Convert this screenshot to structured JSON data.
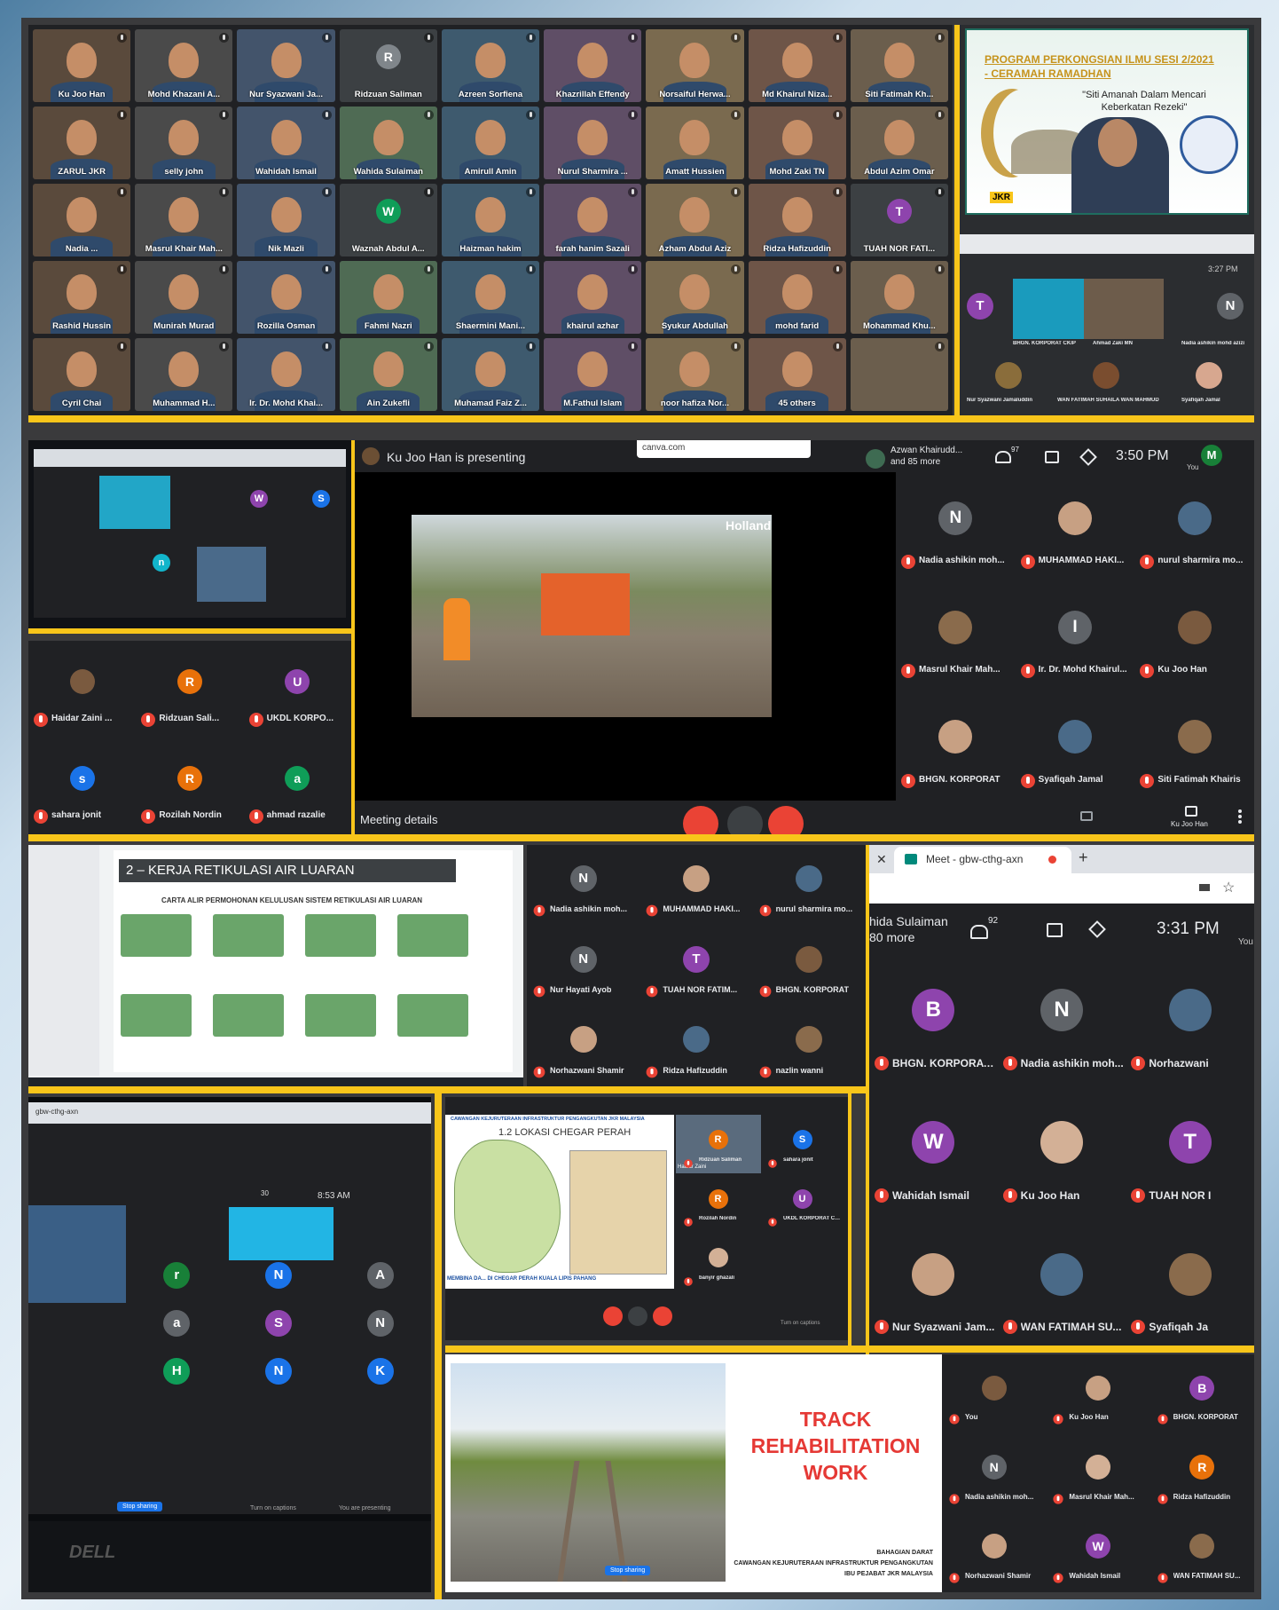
{
  "grid_top_left": {
    "tiles": [
      {
        "name": "Ku Joo Han"
      },
      {
        "name": "Mohd Khazani A..."
      },
      {
        "name": "Nur Syazwani Ja..."
      },
      {
        "name": "Ridzuan Saliman",
        "initial": "R"
      },
      {
        "name": "Azreen Sorfiena"
      },
      {
        "name": "Khazrillah Effendy"
      },
      {
        "name": "Norsaiful Herwa..."
      },
      {
        "name": "Md Khairul Niza..."
      },
      {
        "name": "Siti Fatimah Kh..."
      },
      {
        "name": "ZARUL JKR"
      },
      {
        "name": "selly john"
      },
      {
        "name": "Wahidah Ismail"
      },
      {
        "name": "Wahida Sulaiman"
      },
      {
        "name": "Amirull Amin"
      },
      {
        "name": "Nurul Sharmira ..."
      },
      {
        "name": "Amatt Hussien"
      },
      {
        "name": "Mohd Zaki TN"
      },
      {
        "name": "Abdul Azim Omar"
      },
      {
        "name": "Nadia ..."
      },
      {
        "name": "Masrul Khair Mah..."
      },
      {
        "name": "Nik Mazli"
      },
      {
        "name": "Waznah Abdul A...",
        "initial": "W"
      },
      {
        "name": "Haizman hakim"
      },
      {
        "name": "farah hanim Sazali"
      },
      {
        "name": "Azham Abdul Aziz"
      },
      {
        "name": "Ridza Hafizuddin"
      },
      {
        "name": "TUAH NOR FATI...",
        "initial": "T"
      },
      {
        "name": "Rashid Hussin"
      },
      {
        "name": "Munirah Murad"
      },
      {
        "name": "Rozilla Osman"
      },
      {
        "name": "Fahmi Nazri"
      },
      {
        "name": "Shaermini Mani..."
      },
      {
        "name": "khairul azhar"
      },
      {
        "name": "Syukur Abdullah"
      },
      {
        "name": "mohd farid"
      },
      {
        "name": "Mohammad Khu..."
      },
      {
        "name": "Cyril Chai"
      },
      {
        "name": "Muhammad H..."
      },
      {
        "name": "Ir. Dr. Mohd Khai..."
      },
      {
        "name": "Ain Zukefli"
      },
      {
        "name": "Muhamad Faiz Z..."
      },
      {
        "name": "M.Fathul Islam"
      },
      {
        "name": "noor hafiza Nor..."
      },
      {
        "name": "45 others"
      },
      {
        "name": ""
      }
    ]
  },
  "top_right": {
    "banner_line1": "PROGRAM PERKONGSIAN ILMU SESI 2/2021",
    "banner_line2": "- CERAMAH RAMADHAN",
    "quote": "\"Siti Amanah Dalam Mencari Keberkatan Rezeki\"",
    "logo": "JKR",
    "time": "3:27 PM",
    "names": [
      "BHGN. KORPORAT CKIP",
      "Ahmad Zaki MN",
      "Nadia ashikin mohd azizi",
      "Nur Syazwani Jamaluddin",
      "WAN FATIMAH SUHAILA WAN MAHMUD",
      "Syafiqah Jamal"
    ],
    "initials": [
      "T",
      "N"
    ]
  },
  "small_screen": {
    "initials": [
      "W",
      "S",
      "n"
    ]
  },
  "presenter_panel": {
    "presenting": "Ku Joo Han is presenting",
    "url": "canva.com",
    "participants_summary_line1": "Azwan Khairudd...",
    "participants_summary_line2": "and 85 more",
    "count": "97",
    "time": "3:50 PM",
    "you": "You",
    "me_initial": "M",
    "meeting_details": "Meeting details",
    "self_label": "Ku Joo Han",
    "slide_brand": "Holland",
    "people": [
      {
        "name": "Nadia ashikin moh...",
        "initial": "N"
      },
      {
        "name": "MUHAMMAD HAKI..."
      },
      {
        "name": "nurul sharmira mo..."
      },
      {
        "name": "Masrul Khair Mah..."
      },
      {
        "name": "Ir. Dr. Mohd Khairul...",
        "initial": "I"
      },
      {
        "name": "Ku Joo Han"
      },
      {
        "name": "BHGN. KORPORAT"
      },
      {
        "name": "Syafiqah Jamal"
      },
      {
        "name": "Siti Fatimah Khairis"
      }
    ]
  },
  "left_people": {
    "people": [
      {
        "name": "Haidar Zaini ..."
      },
      {
        "name": "Ridzuan Sali...",
        "initial": "R"
      },
      {
        "name": "UKDL KORPO...",
        "initial": "U"
      },
      {
        "name": "sahara jonit",
        "initial": "s"
      },
      {
        "name": "Rozilah Nordin",
        "initial": "R"
      },
      {
        "name": "ahmad razalie",
        "initial": "a"
      }
    ]
  },
  "slide_panel": {
    "heading": "2 – KERJA RETIKULASI AIR LUARAN",
    "subheading": "CARTA ALIR PERMOHONAN KELULUSAN SISTEM RETIKULASI AIR LUARAN",
    "people": [
      {
        "name": "Nadia ashikin moh...",
        "initial": "N"
      },
      {
        "name": "MUHAMMAD HAKI..."
      },
      {
        "name": "nurul sharmira mo..."
      },
      {
        "name": "Nur Hayati Ayob",
        "initial": "N"
      },
      {
        "name": "TUAH NOR FATIM...",
        "initial": "T"
      },
      {
        "name": "BHGN. KORPORAT"
      },
      {
        "name": "Norhazwani Shamir"
      },
      {
        "name": "Ridza Hafizuddin"
      },
      {
        "name": "nazlin wanni"
      }
    ]
  },
  "right_browser": {
    "tab_title": "Meet - gbw-cthg-axn",
    "summary_line1": "hida Sulaiman",
    "summary_line2": "80 more",
    "count": "92",
    "time": "3:31 PM",
    "you": "You",
    "people": [
      {
        "name": "BHGN. KORPORAT ...",
        "initial": "B"
      },
      {
        "name": "Nadia ashikin moh...",
        "initial": "N"
      },
      {
        "name": "Norhazwani"
      },
      {
        "name": "Wahidah Ismail",
        "initial": "W"
      },
      {
        "name": "Ku Joo Han"
      },
      {
        "name": "TUAH NOR I",
        "initial": "T"
      },
      {
        "name": "Nur Syazwani Jam..."
      },
      {
        "name": "WAN FATIMAH SU..."
      },
      {
        "name": "Syafiqah Ja"
      }
    ]
  },
  "laptop": {
    "tab": "gbw-cthg-axn",
    "time": "8:53 AM",
    "count": "30",
    "initials": [
      "r",
      "N",
      "A",
      "a",
      "S",
      "N",
      "H",
      "N",
      "K"
    ],
    "sharing": "Stop sharing",
    "captions": "Turn on captions",
    "presenting": "You are presenting",
    "brand": "DELL"
  },
  "map_panel": {
    "header": "CAWANGAN KEJURUTERAAN INFRASTRUKTUR PENGANGKUTAN JKR MALAYSIA",
    "title": "1.2 LOKASI CHEGAR PERAH",
    "footer": "MEMBINA DA... DI CHEGAR PERAH KUALA LIPIS PAHANG",
    "people": [
      {
        "name": "Ridzuan Saliman",
        "initial": "R"
      },
      {
        "name": "sahara jonit",
        "initial": "S"
      },
      {
        "name": "Rozilah Nordin",
        "initial": "R"
      },
      {
        "name": "UKDL KORPORAT CKIP",
        "initial": "U"
      },
      {
        "name": "banyir ghazali"
      }
    ],
    "presenter": "Haidar Zaini",
    "captions": "Turn on captions"
  },
  "track_panel": {
    "title_l1": "TRACK",
    "title_l2": "REHABILITATION",
    "title_l3": "WORK",
    "foot1": "BAHAGIAN DARAT",
    "foot2": "CAWANGAN KEJURUTERAAN INFRASTRUKTUR PENGANGKUTAN",
    "foot3": "IBU PEJABAT JKR MALAYSIA",
    "sharing": "Stop sharing",
    "people": [
      {
        "name": "You"
      },
      {
        "name": "Ku Joo Han"
      },
      {
        "name": "BHGN. KORPORAT",
        "initial": "B"
      },
      {
        "name": "Nadia ashikin moh...",
        "initial": "N"
      },
      {
        "name": "Masrul Khair Mah..."
      },
      {
        "name": "Ridza Hafizuddin",
        "initial": "R"
      },
      {
        "name": "Norhazwani Shamir"
      },
      {
        "name": "Wahidah Ismail",
        "initial": "W"
      },
      {
        "name": "WAN FATIMAH SU..."
      }
    ]
  },
  "colors": {
    "accent": "#f8c51a",
    "meet_bg": "#202124",
    "tile": "#3c4043",
    "red": "#ea4335"
  }
}
